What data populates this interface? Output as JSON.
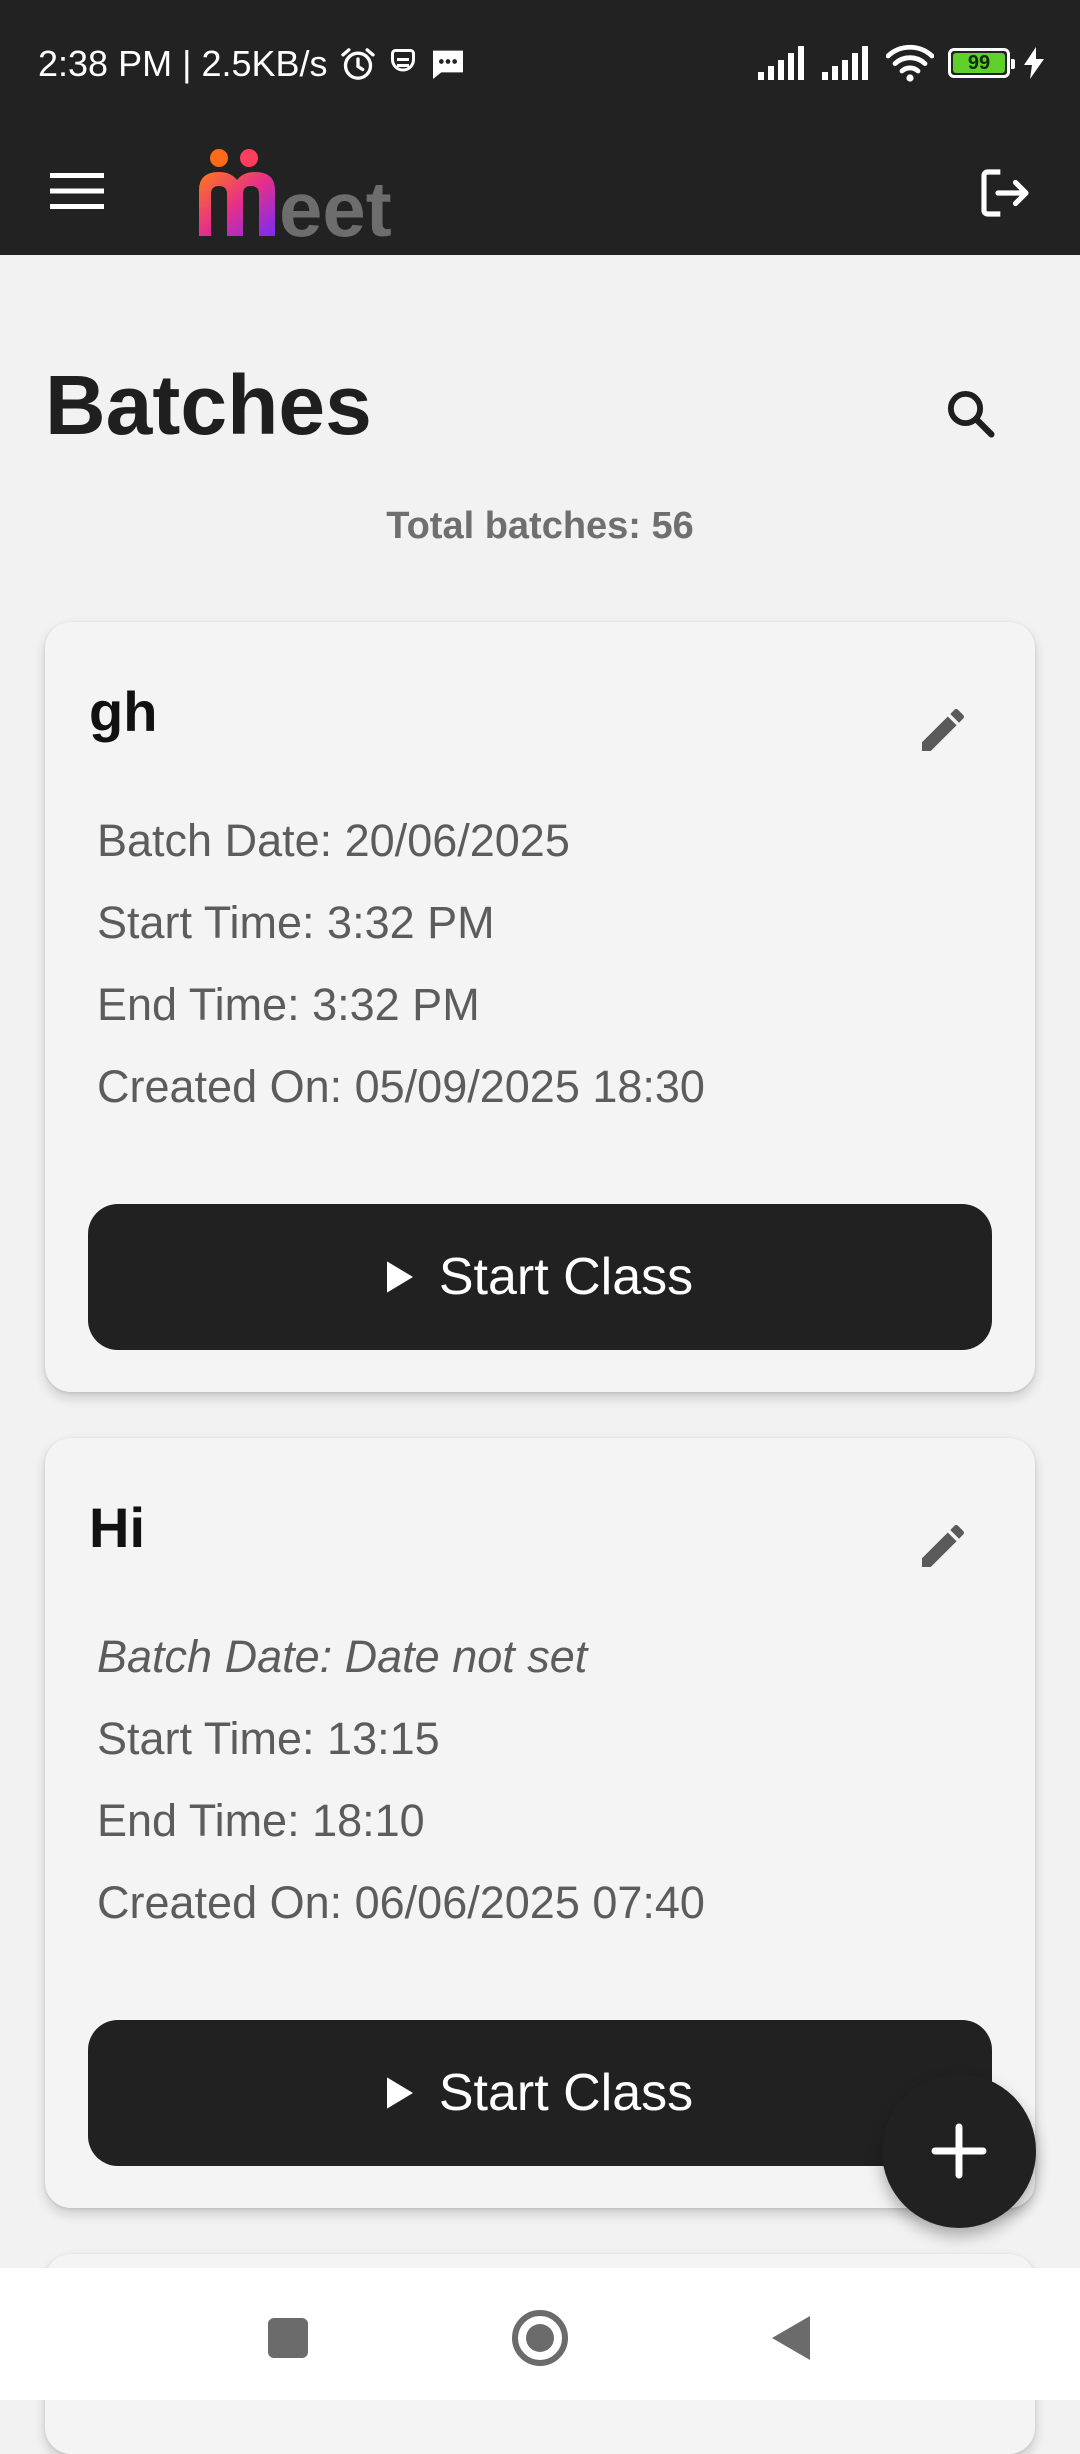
{
  "status_bar": {
    "time": "2:38 PM",
    "separator": "|",
    "net_speed": "2.5KB/s",
    "battery": "99",
    "icons": [
      "alarm-icon",
      "sim-notification-icon",
      "message-icon",
      "signal-icon",
      "signal-icon",
      "wifi-icon",
      "battery-icon",
      "charging-icon"
    ]
  },
  "app_bar": {
    "logo_text": "meet",
    "icons": [
      "menu-icon",
      "logout-icon"
    ],
    "background": "#222222"
  },
  "page": {
    "title": "Batches",
    "total": "Total batches: 56"
  },
  "batches": [
    {
      "name": "gh",
      "batch_date": "Batch Date: 20/06/2025",
      "start_time": "Start Time: 3:32 PM",
      "end_time": "End Time: 3:32 PM",
      "created_on": "Created On: 05/09/2025 18:30",
      "action_label": "Start Class"
    },
    {
      "name": "Hi",
      "batch_date": "Batch Date: Date not set",
      "start_time": "Start Time: 13:15",
      "end_time": "End Time: 18:10",
      "created_on": "Created On: 06/06/2025 07:40",
      "action_label": "Start Class"
    }
  ],
  "colors": {
    "accent": "#212121",
    "background": "#f2f2f2",
    "card": "#f4f4f4",
    "muted_text": "#5c5c5c",
    "logo_gradient": [
      "#ff7a1a",
      "#e62e8a",
      "#7a2cf5"
    ]
  }
}
